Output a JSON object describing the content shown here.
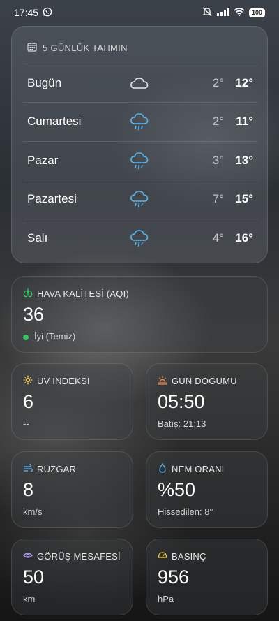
{
  "status": {
    "time": "17:45",
    "battery": "100",
    "icons": [
      "whatsapp-icon",
      "silent-icon",
      "signal-icon",
      "wifi-icon",
      "battery-icon"
    ]
  },
  "forecast": {
    "title": "5 GÜNLÜK TAHMIN",
    "days": [
      {
        "day": "Bugün",
        "icon": "cloudy-icon",
        "low": "2°",
        "high": "12°"
      },
      {
        "day": "Cumartesi",
        "icon": "rain-icon",
        "low": "2°",
        "high": "11°"
      },
      {
        "day": "Pazar",
        "icon": "rain-icon",
        "low": "3°",
        "high": "13°"
      },
      {
        "day": "Pazartesi",
        "icon": "rain-icon",
        "low": "7°",
        "high": "15°"
      },
      {
        "day": "Salı",
        "icon": "rain-icon",
        "low": "4°",
        "high": "16°"
      }
    ]
  },
  "aqi": {
    "label": "HAVA KALİTESİ (AQI)",
    "value": "36",
    "status": "İyi (Temiz)",
    "status_color": "#3fc36a"
  },
  "uv": {
    "label": "UV İNDEKSİ",
    "value": "6",
    "sub": "--"
  },
  "sunrise": {
    "label": "GÜN DOĞUMU",
    "value": "05:50",
    "sub": "Batış: 21:13"
  },
  "wind": {
    "label": "RÜZGAR",
    "value": "8",
    "sub": "km/s"
  },
  "humidity": {
    "label": "NEM ORANI",
    "value": "%50",
    "sub": "Hissedilen: 8°"
  },
  "visibility": {
    "label": "GÖRÜŞ MESAFESİ",
    "value": "50",
    "sub": "km"
  },
  "pressure": {
    "label": "BASINÇ",
    "value": "956",
    "sub": "hPa"
  },
  "colors": {
    "accent_blue": "#5ab4f0",
    "aqi_green": "#3fc36a",
    "uv_yellow": "#f5c84a",
    "sunrise_orange": "#f08a5a",
    "visibility_purple": "#b49cf0",
    "pressure_yellow": "#f5d04a"
  }
}
